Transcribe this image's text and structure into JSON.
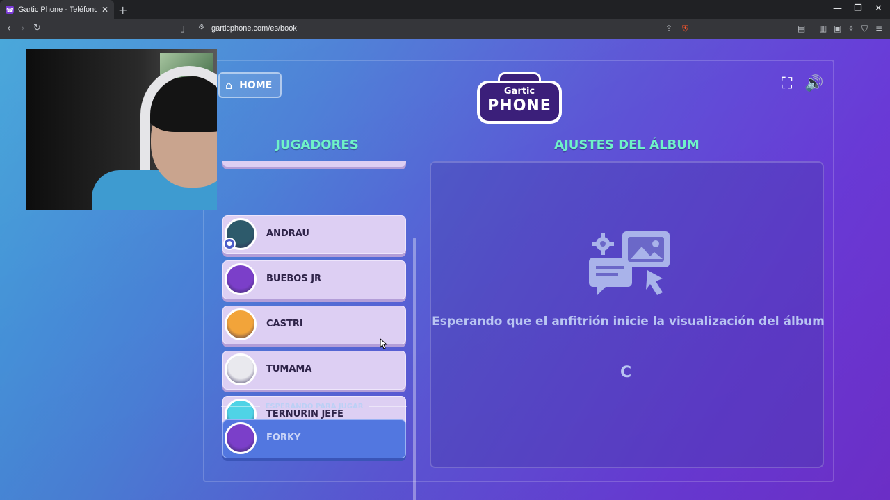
{
  "browser": {
    "tab_title": "Gartic Phone - Teléfono Descom",
    "url": "garticphone.com/es/book",
    "new_tab": "+",
    "tab_close": "✕",
    "window_controls": [
      "—",
      "❐",
      "✕"
    ]
  },
  "game": {
    "home_label": "HOME",
    "logo_top": "Gartic",
    "logo_main": "PHONE",
    "players_heading": "JUGADORES",
    "album_heading": "AJUSTES DEL ÁLBUM",
    "players": [
      {
        "name": "ANDRAU",
        "avatar_color": "#2d5a6b",
        "host": true
      },
      {
        "name": "BUEBOS JR",
        "avatar_color": "#7b3fc9",
        "host": false
      },
      {
        "name": "CASTRI",
        "avatar_color": "#f2a43a",
        "host": false
      },
      {
        "name": "TUMAMA",
        "avatar_color": "#e9e9ee",
        "host": false
      },
      {
        "name": "TERNURIN JEFE",
        "avatar_color": "#4fd3e6",
        "host": false
      }
    ],
    "waiting_label": "ESPERANDO PARA JUGAR",
    "waiting_players": [
      {
        "name": "FORKY",
        "avatar_color": "#7b3fc9"
      }
    ],
    "waiting_message": "Esperando que el anfitrión inicie la visualización del álbum",
    "spinner": "C"
  },
  "colors": {
    "heading": "#6ff2c8",
    "player_card": "#ddcff3",
    "waiting_card": "#5277e0"
  }
}
